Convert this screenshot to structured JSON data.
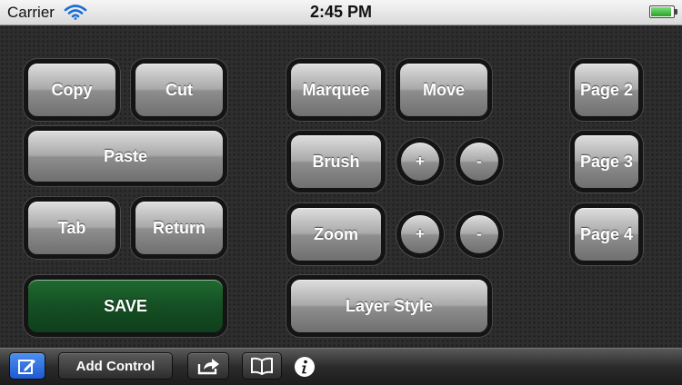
{
  "status_bar": {
    "carrier": "Carrier",
    "time": "2:45 PM",
    "battery_level": 1.0,
    "icons": [
      "wifi-icon",
      "battery-icon"
    ]
  },
  "controls": {
    "copy": "Copy",
    "cut": "Cut",
    "paste": "Paste",
    "tab": "Tab",
    "return": "Return",
    "save": "SAVE",
    "marquee": "Marquee",
    "move": "Move",
    "brush": "Brush",
    "brush_plus": "+",
    "brush_minus": "-",
    "zoom": "Zoom",
    "zoom_plus": "+",
    "zoom_minus": "-",
    "layer_style": "Layer Style",
    "page2": "Page 2",
    "page3": "Page 3",
    "page4": "Page 4"
  },
  "toolbar": {
    "add_control": "Add Control",
    "icons": [
      "edit-icon",
      "share-icon",
      "book-icon",
      "info-icon"
    ]
  },
  "colors": {
    "save_green": "#1a5a2a",
    "edit_blue": "#2a6ee0"
  }
}
